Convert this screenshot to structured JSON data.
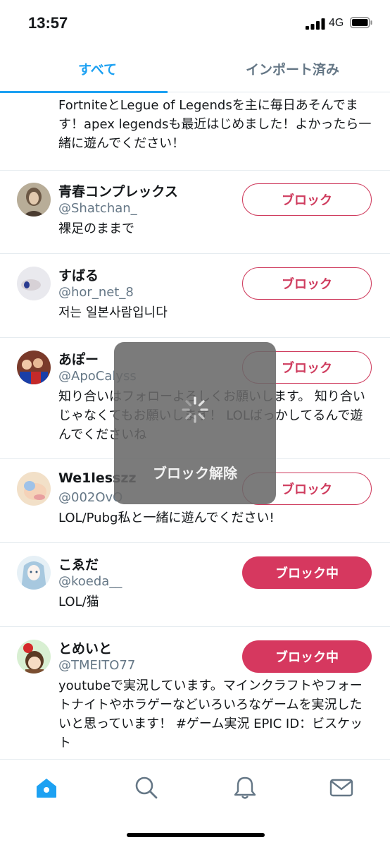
{
  "status": {
    "time": "13:57",
    "network": "4G"
  },
  "tabs": [
    {
      "label": "すべて"
    },
    {
      "label": "インポート済み"
    }
  ],
  "rows": [
    {
      "bio": "FortniteとLegue of Legendsを主に毎日あそんでます！apex legendsも最近はじめました！よかったら一緒に遊んでください！"
    },
    {
      "name": "青春コンプレックス",
      "handle": "@Shatchan_",
      "bio": "裸足のままで",
      "button": "ブロック"
    },
    {
      "name": "すばる",
      "handle": "@hor_net_8",
      "bio": "저는 일본사람입니다",
      "button": "ブロック"
    },
    {
      "name": "あぽー",
      "handle": "@ApoCalyss",
      "bio": "知り合いはフォローよろしくお願いします。 知り合いじゃなくてもお願いします！ LOLばっかしてるんで遊んでくださいね",
      "button": "ブロック"
    },
    {
      "name": "We1lesszz",
      "handle": "@002OvO",
      "bio": "LOL/Pubg私と一緒に遊んでください!",
      "button": "ブロック"
    },
    {
      "name": "こゑだ",
      "handle": "@koeda__",
      "bio": "LOL/猫",
      "button": "ブロック中"
    },
    {
      "name": "とめいと",
      "handle": "@TMEITO77",
      "bio": "youtubeで実況しています。マインクラフトやフォートナイトやホラゲーなどいろいろなゲームを実況したいと思っています！ #ゲーム実況 EPIC ID：ビスケット",
      "button": "ブロック中"
    }
  ],
  "hud": {
    "label": "ブロック解除"
  },
  "colors": {
    "accent": "#1da1f2",
    "block": "#d6385f",
    "muted": "#657786"
  },
  "icons": {
    "home": "home-icon",
    "search": "search-icon",
    "notifications": "bell-icon",
    "messages": "mail-icon"
  }
}
